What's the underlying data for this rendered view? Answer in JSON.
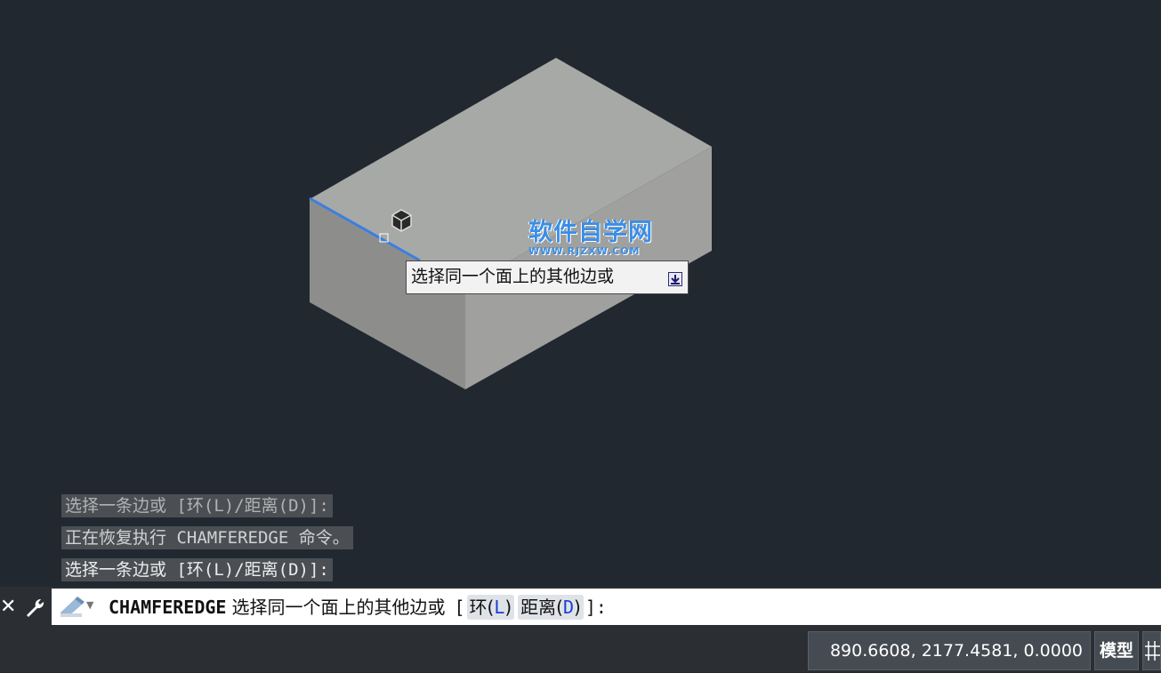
{
  "watermark": {
    "main": "软件自学网",
    "sub": "WWW.RJZXW.COM"
  },
  "tooltip": {
    "text": "选择同一个面上的其他边或"
  },
  "history": [
    "选择一条边或 [环(L)/距离(D)]:",
    "正在恢复执行 CHAMFEREDGE 命令。",
    "选择一条边或 [环(L)/距离(D)]:"
  ],
  "command": {
    "name": "CHAMFEREDGE",
    "prompt": "选择同一个面上的其他边或",
    "open_bracket": "[",
    "option1_label": "环(",
    "option1_key": "L",
    "option1_close": ")",
    "option2_label": "距离(",
    "option2_key": "D",
    "option2_close": ")",
    "close_bracket": "]:"
  },
  "status": {
    "coordinates": "890.6608, 2177.4581, 0.0000",
    "model": "模型"
  },
  "colors": {
    "viewport_bg": "#212830",
    "box_top": "#a7a9a6",
    "box_left": "#8d8e8c",
    "box_right": "#a0a09e",
    "selected_edge": "#3a7fe0",
    "watermark": "#3a8ee6"
  },
  "icons": {
    "close": "close-icon",
    "tool": "wrench-icon",
    "command": "pencil-command-icon",
    "cursor": "3d-cube-cursor-icon",
    "tooltip_expand": "download-arrow-icon",
    "grid": "grid-icon"
  }
}
